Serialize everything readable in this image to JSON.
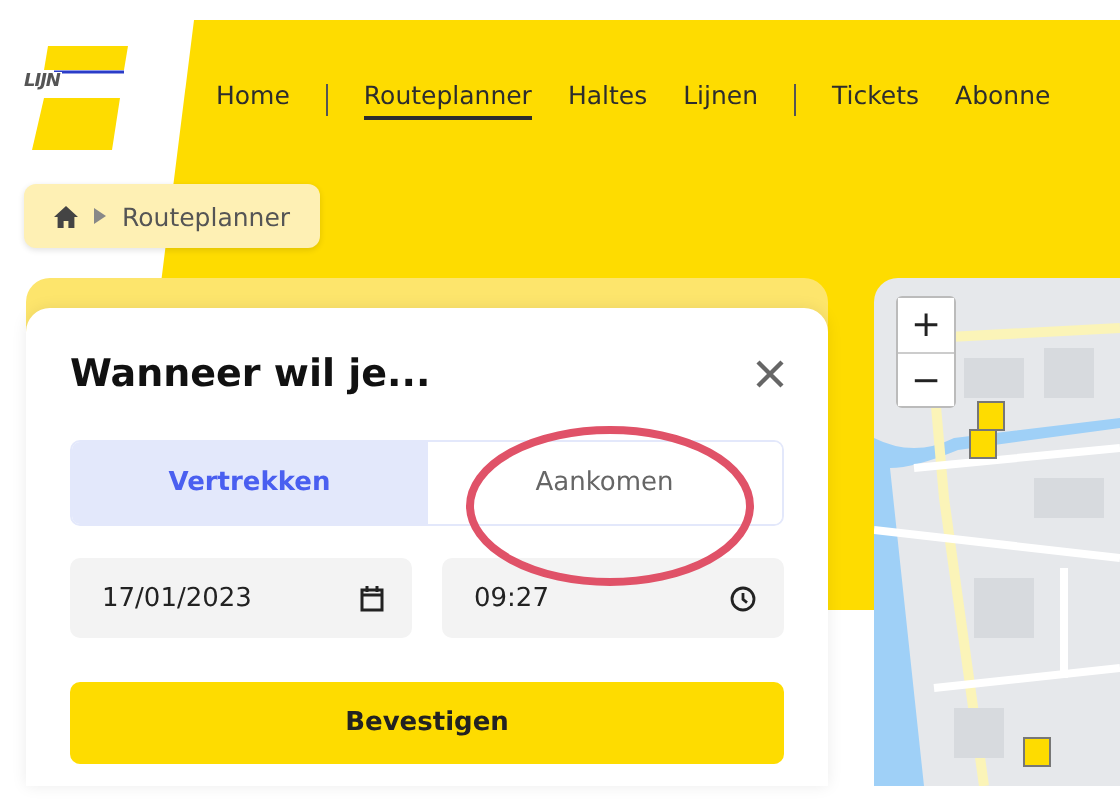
{
  "logo": {
    "text": "LIJN"
  },
  "nav": {
    "items": [
      {
        "kind": "link",
        "label": "Home",
        "selected": false
      },
      {
        "kind": "separator"
      },
      {
        "kind": "link",
        "label": "Routeplanner",
        "selected": true
      },
      {
        "kind": "link",
        "label": "Haltes",
        "selected": false
      },
      {
        "kind": "link",
        "label": "Lijnen",
        "selected": false
      },
      {
        "kind": "separator"
      },
      {
        "kind": "link",
        "label": "Tickets",
        "selected": false
      },
      {
        "kind": "link",
        "label": "Abonne",
        "selected": false
      }
    ]
  },
  "breadcrumb": {
    "items": [
      "Routeplanner"
    ]
  },
  "dialog": {
    "title": "Wanneer wil je...",
    "modes": [
      {
        "label": "Vertrekken",
        "selected": true
      },
      {
        "label": "Aankomen",
        "selected": false
      }
    ],
    "date": {
      "value": "17/01/2023"
    },
    "time": {
      "value": "09:27"
    },
    "confirm": "Bevestigen"
  },
  "map": {
    "zoom_in": "+",
    "zoom_out": "−"
  }
}
